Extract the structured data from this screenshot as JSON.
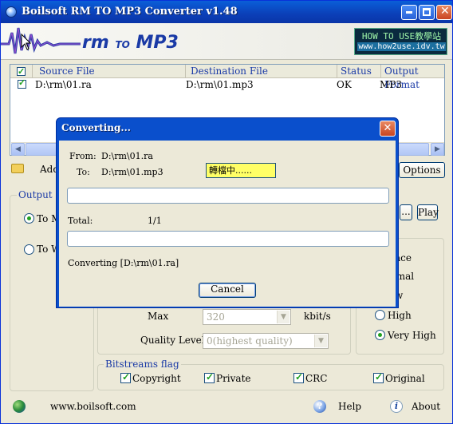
{
  "window": {
    "title": "Boilsoft RM TO MP3 Converter v1.48",
    "banner_logo": "rm",
    "banner_to": "TO",
    "banner_target": "MP3",
    "badge_line1": "HOW TO USE教學站",
    "badge_line2": "www.how2use.idv.tw"
  },
  "file_list": {
    "columns": [
      "Source File",
      "Destination File",
      "Status",
      "Output Format"
    ],
    "rows": [
      {
        "source": "D:\\rm\\01.ra",
        "destination": "D:\\rm\\01.mp3",
        "status": "OK",
        "format": "MP3"
      }
    ]
  },
  "toolbar": {
    "add_label": "Add",
    "options_label": "Options"
  },
  "output": {
    "group_label": "Output Fo",
    "option1": "To M",
    "option2": "To W",
    "dots_label": "...",
    "play_label": "Play"
  },
  "settings": {
    "max_label": "Max",
    "max_value": "320",
    "kbits_label": "kbit/s",
    "quality_label": "Quality Level:",
    "quality_value": "0(highest quality)"
  },
  "quality": {
    "partial1": "ace",
    "partial2": "rmal",
    "partial3": "w",
    "high_label": "High",
    "very_high_label": "Very High"
  },
  "bitstreams": {
    "group_label": "Bitstreams flag",
    "copyright": "Copyright",
    "private": "Private",
    "crc": "CRC",
    "original": "Original"
  },
  "footer": {
    "website": "www.boilsoft.com",
    "help": "Help",
    "about": "About"
  },
  "dialog": {
    "title": "Converting...",
    "from_label": "From:",
    "from_value": "D:\\rm\\01.ra",
    "to_label": "To:",
    "to_value": "D:\\rm\\01.mp3",
    "status_text": "轉檔中......",
    "total_label": "Total:",
    "total_value": "1/1",
    "converting_text": "Converting [D:\\rm\\01.ra]",
    "cancel_label": "Cancel"
  }
}
